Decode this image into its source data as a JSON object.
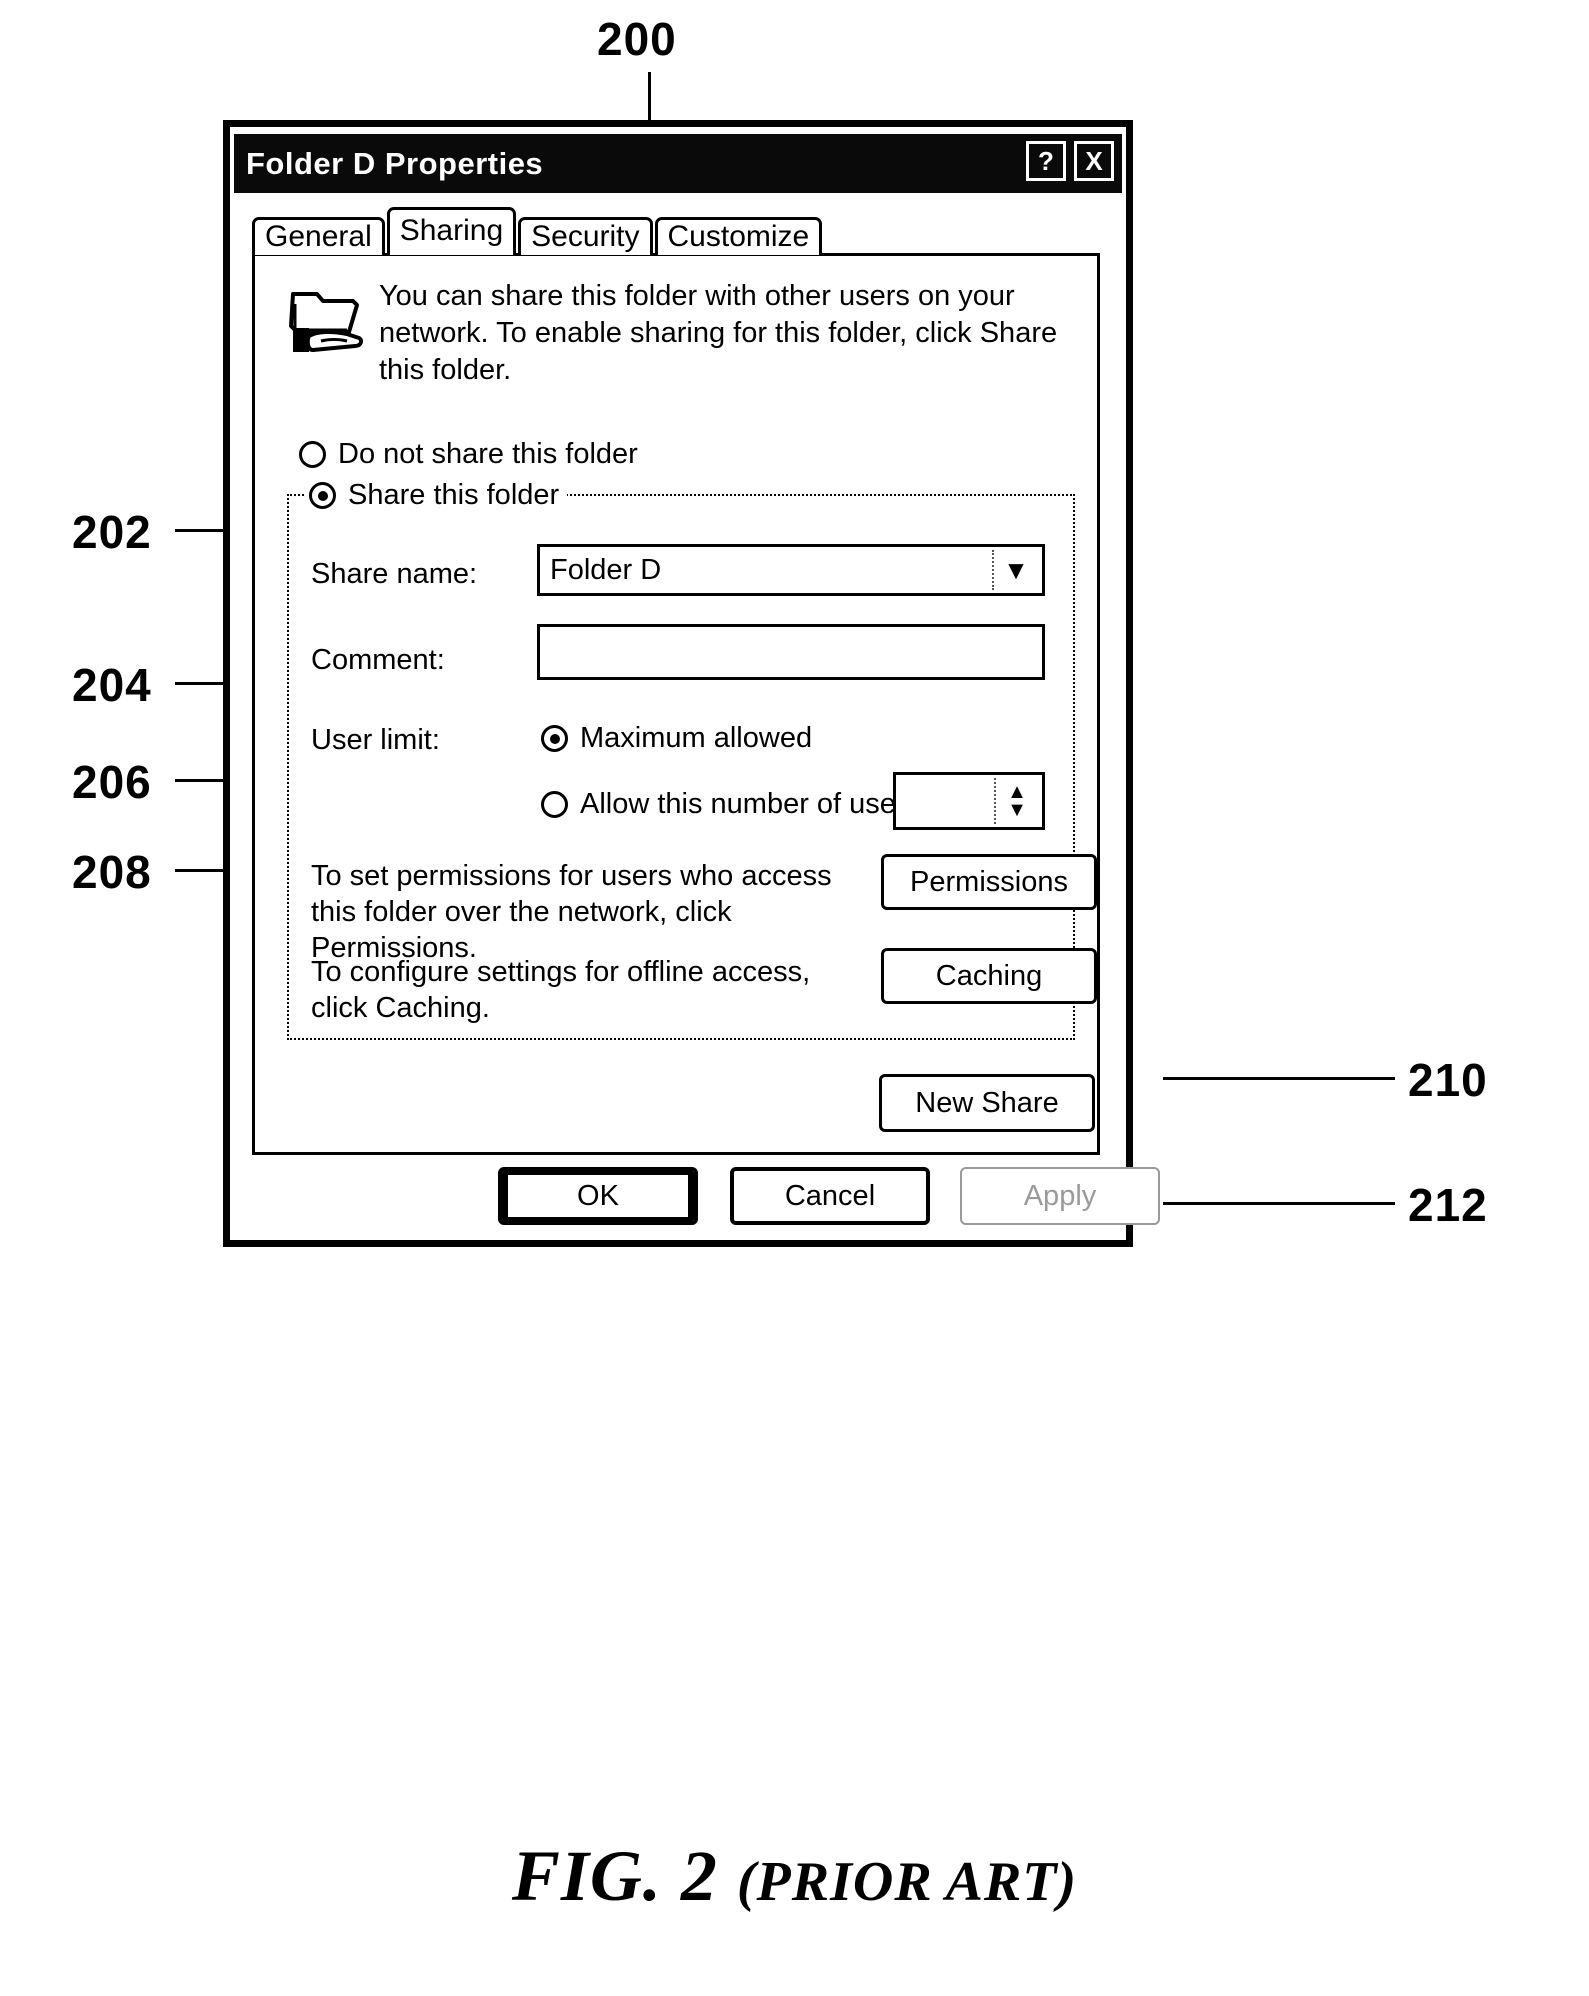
{
  "figure": {
    "caption_main": "FIG. 2",
    "caption_suffix": "(PRIOR ART)",
    "callouts": {
      "dialog": "200",
      "do_not_share": "202",
      "share_name": "204",
      "comment": "206",
      "user_limit": "208",
      "permissions": "210",
      "caching": "212"
    }
  },
  "dialog": {
    "title": "Folder D Properties",
    "help_button": "?",
    "close_button": "X",
    "tabs": [
      {
        "label": "General",
        "active": false
      },
      {
        "label": "Sharing",
        "active": true
      },
      {
        "label": "Security",
        "active": false
      },
      {
        "label": "Customize",
        "active": false
      }
    ],
    "sharing": {
      "folder_icon": "shared-folder-icon",
      "description": "You can share this folder with other users on your network.  To enable sharing for this folder, click Share this folder.",
      "do_not_share_label": "Do not share this folder",
      "do_not_share_checked": false,
      "share_this_folder_label": "Share this folder",
      "share_this_folder_checked": true,
      "share_name_label": "Share name:",
      "share_name_value": "Folder D",
      "share_name_placeholder": "",
      "comment_label": "Comment:",
      "comment_value": "",
      "comment_placeholder": "",
      "user_limit_label": "User limit:",
      "maximum_allowed_label": "Maximum allowed",
      "maximum_allowed_checked": true,
      "allow_number_label": "Allow this number of users:",
      "allow_number_checked": false,
      "allow_number_value": "",
      "permissions_text": "To set permissions for users who access this folder over the network, click Permissions.",
      "permissions_button": "Permissions",
      "caching_text": "To configure settings for offline access, click Caching.",
      "caching_button": "Caching",
      "new_share_button": "New Share"
    },
    "footer": {
      "ok_button": "OK",
      "cancel_button": "Cancel",
      "apply_button": "Apply",
      "apply_disabled": true
    }
  }
}
